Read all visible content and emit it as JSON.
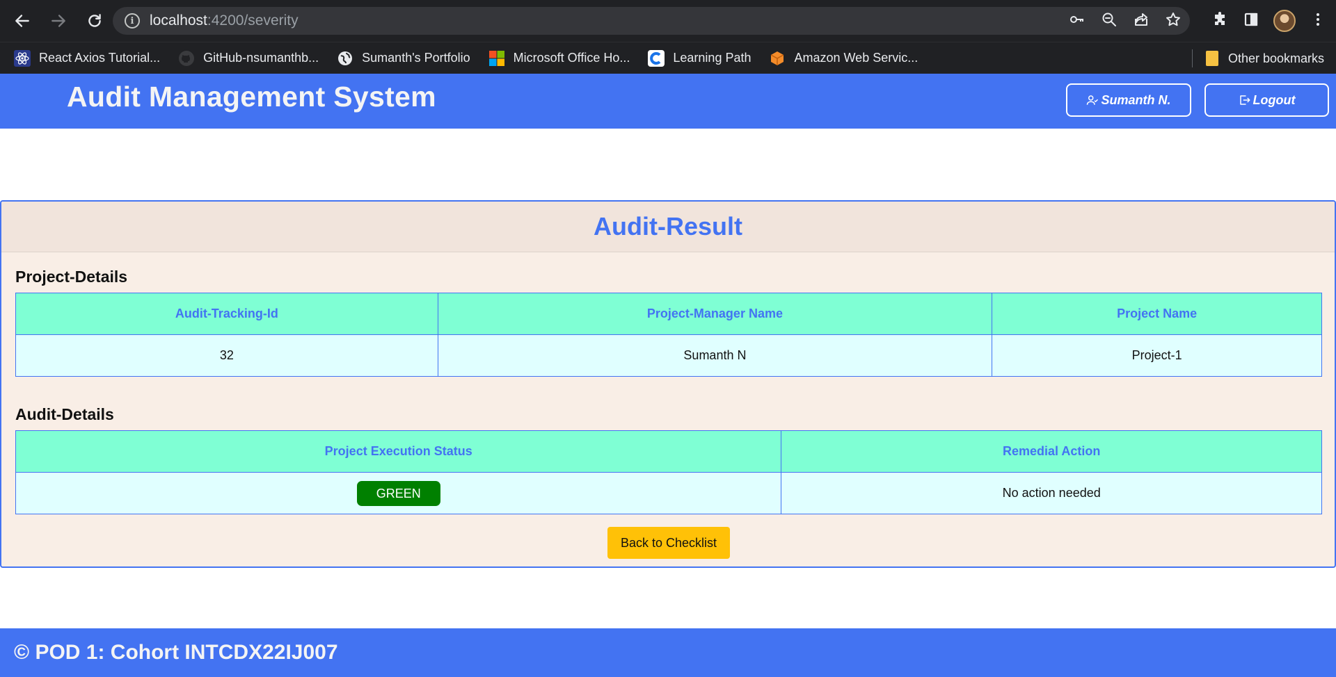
{
  "browser": {
    "url_host": "localhost",
    "url_path": ":4200/severity",
    "bookmarks": [
      {
        "label": "React Axios Tutorial..."
      },
      {
        "label": "GitHub-nsumanthb..."
      },
      {
        "label": "Sumanth's Portfolio"
      },
      {
        "label": "Microsoft Office Ho..."
      },
      {
        "label": "Learning Path"
      },
      {
        "label": "Amazon Web Servic..."
      }
    ],
    "other_bookmarks": "Other bookmarks"
  },
  "header": {
    "title": "Audit Management System",
    "user_label": "Sumanth N.",
    "logout_label": "Logout"
  },
  "result": {
    "title": "Audit-Result",
    "project_section": "Project-Details",
    "project_table": {
      "headers": [
        "Audit-Tracking-Id",
        "Project-Manager Name",
        "Project Name"
      ],
      "row": [
        "32",
        "Sumanth N",
        "Project-1"
      ]
    },
    "audit_section": "Audit-Details",
    "audit_table": {
      "headers": [
        "Project Execution Status",
        "Remedial Action"
      ],
      "status": "GREEN",
      "action": "No action needed"
    },
    "back_label": "Back to Checklist"
  },
  "footer": {
    "text": "© POD 1: Cohort INTCDX22IJ007"
  },
  "colors": {
    "brand_blue": "#4373f2",
    "header_cell": "#7fffd4",
    "body_cell": "#e0ffff",
    "status_green": "#008000",
    "back_button": "#ffc107"
  }
}
